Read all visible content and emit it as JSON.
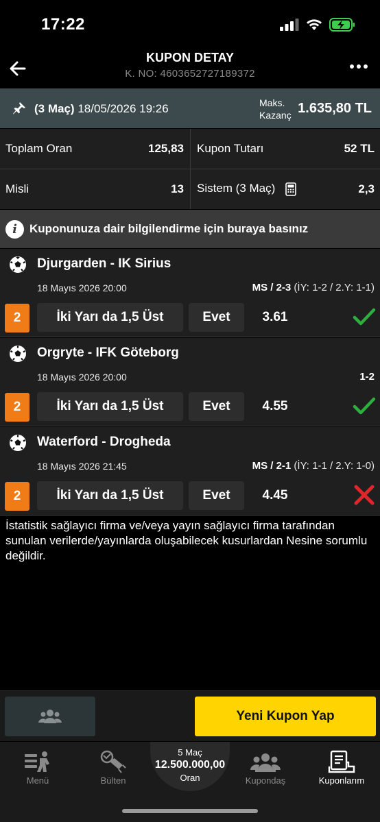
{
  "status_bar": {
    "time": "17:22"
  },
  "header": {
    "title": "KUPON DETAY",
    "coupon_no": "K. NO: 4603652727189372"
  },
  "summary": {
    "match_count": "(3 Maç)",
    "datetime": "18/05/2026 19:26",
    "max_label_1": "Maks.",
    "max_label_2": "Kazanç",
    "max_win": "1.635,80 TL"
  },
  "grid": {
    "total_odds_label": "Toplam Oran",
    "total_odds_value": "125,83",
    "amount_label": "Kupon Tutarı",
    "amount_value": "52 TL",
    "misli_label": "Misli",
    "misli_value": "13",
    "system_label": "Sistem (3 Maç)",
    "system_value": "2,3"
  },
  "banner": {
    "text": "Kuponunuza dair bilgilendirme için buraya basınız"
  },
  "matches": [
    {
      "teams": "Djurgarden - IK Sirius",
      "date": "18 Mayıs 2026 20:00",
      "result_main": "MS / 2-3",
      "result_detail": " (İY: 1-2 / 2.Y: 1-1)",
      "badge": "2",
      "market": "İki Yarı da 1,5 Üst",
      "pick": "Evet",
      "odd": "3.61",
      "status": "won"
    },
    {
      "teams": "Orgryte - IFK Göteborg",
      "date": "18 Mayıs 2026 20:00",
      "result_main": "1-2",
      "result_detail": "",
      "badge": "2",
      "market": "İki Yarı da 1,5 Üst",
      "pick": "Evet",
      "odd": "4.55",
      "status": "won"
    },
    {
      "teams": "Waterford - Drogheda",
      "date": "18 Mayıs 2026 21:45",
      "result_main": "MS / 2-1",
      "result_detail": " (İY: 1-1 / 2.Y: 1-0)",
      "badge": "2",
      "market": "İki Yarı da 1,5 Üst",
      "pick": "Evet",
      "odd": "4.45",
      "status": "lost"
    }
  ],
  "disclaimer": "İstatistik sağlayıcı firma ve/veya yayın sağlayıcı firma tarafından sunulan verilerde/yayınlarda oluşabilecek kusurlardan Nesine sorumlu değildir.",
  "actions": {
    "new_coupon": "Yeni Kupon Yap"
  },
  "tabbar": {
    "menu": "Menü",
    "bulten": "Bülten",
    "center_line1": "5 Maç",
    "center_line2": "12.500.000,00",
    "center_line3": "Oran",
    "kupondas": "Kupondaş",
    "kuponlarim": "Kuponlarım"
  },
  "colors": {
    "accent_yellow": "#ffd400",
    "badge_orange": "#f07c17",
    "won_green": "#2eae3e",
    "lost_red": "#e0252b",
    "summary_bg": "#3c4a4e"
  }
}
